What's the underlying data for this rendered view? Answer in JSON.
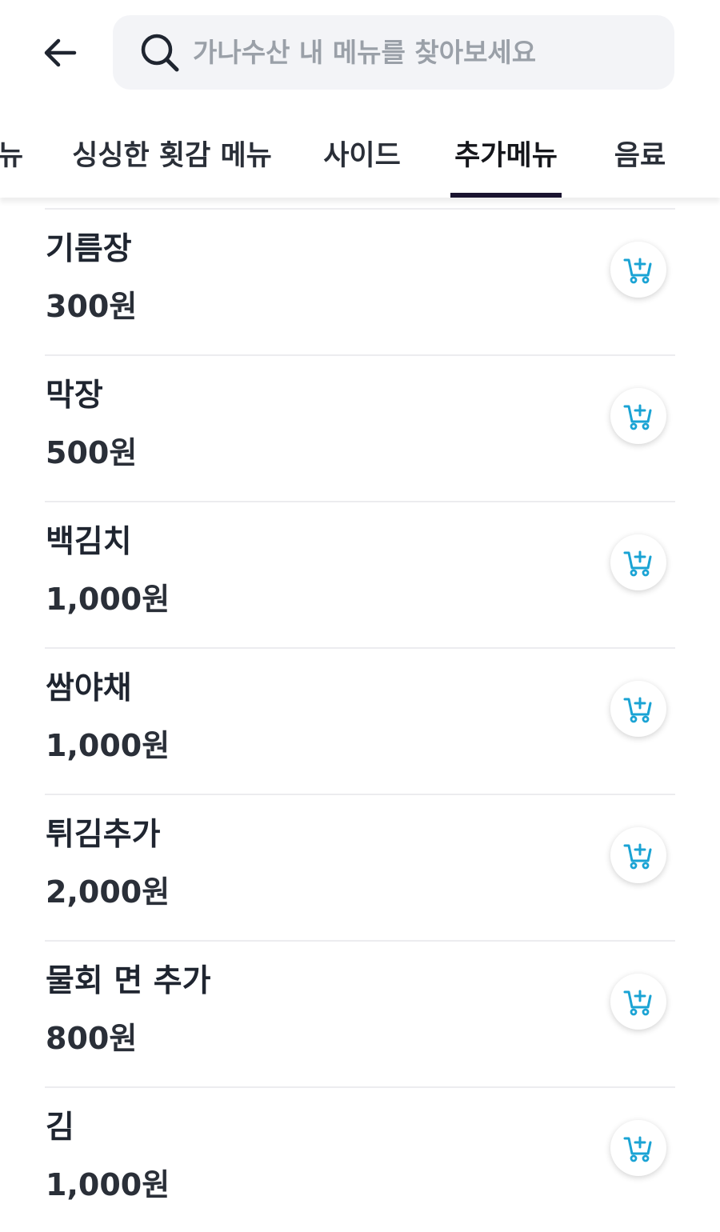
{
  "search": {
    "placeholder": "가나수산 내 메뉴를 찾아보세요",
    "value": ""
  },
  "tabs": [
    {
      "label": "뉴",
      "active": false
    },
    {
      "label": "싱싱한 횟감 메뉴",
      "active": false
    },
    {
      "label": "사이드",
      "active": false
    },
    {
      "label": "추가메뉴",
      "active": true
    },
    {
      "label": "음료",
      "active": false
    }
  ],
  "items": [
    {
      "name": "기름장",
      "price": "300원"
    },
    {
      "name": "막장",
      "price": "500원"
    },
    {
      "name": "백김치",
      "price": "1,000원"
    },
    {
      "name": "쌈야채",
      "price": "1,000원"
    },
    {
      "name": "튀김추가",
      "price": "2,000원"
    },
    {
      "name": "물회 면 추가",
      "price": "800원"
    },
    {
      "name": "김",
      "price": "1,000원"
    }
  ],
  "colors": {
    "accent": "#1aa3d4",
    "tab_indicator": "#1a1430",
    "search_bg": "#f3f4f7"
  },
  "icons": {
    "back": "arrow-left-icon",
    "search": "search-icon",
    "cart_add": "cart-plus-icon"
  }
}
